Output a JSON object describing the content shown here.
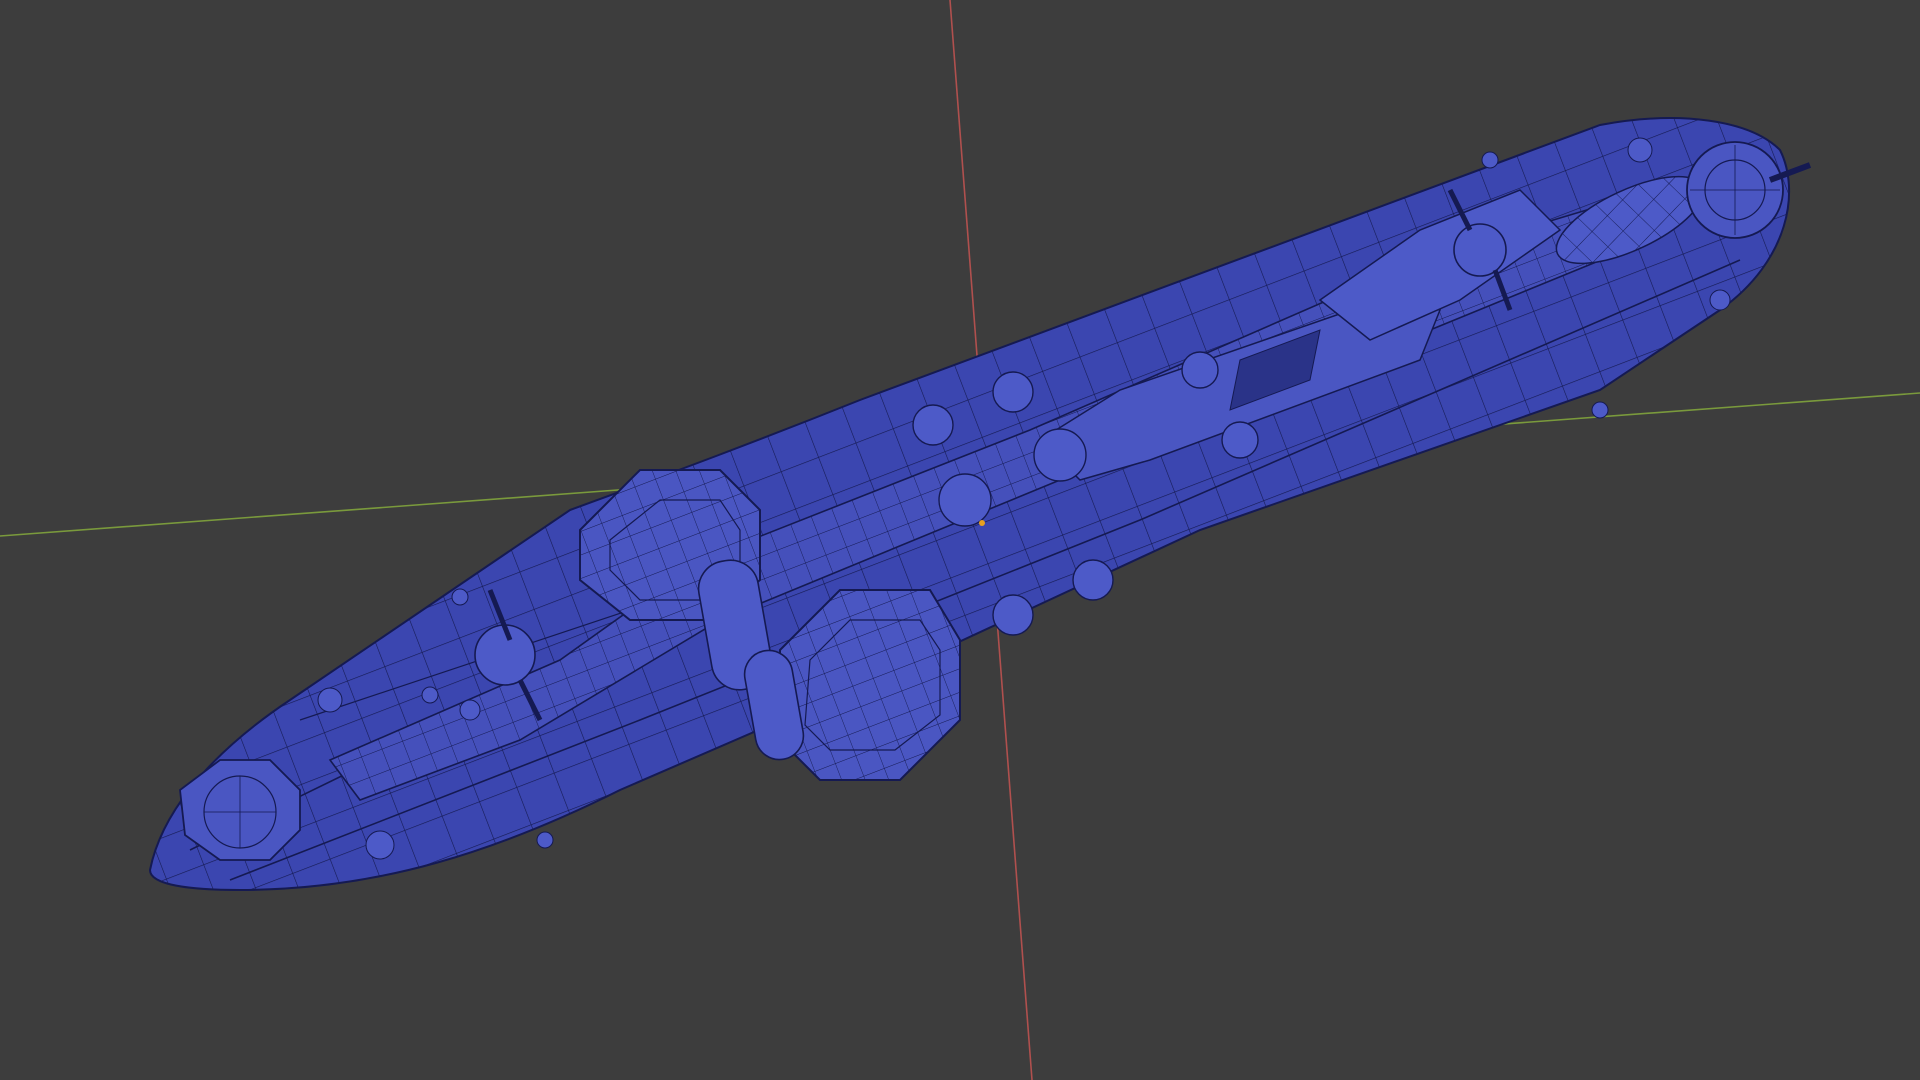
{
  "viewport": {
    "background": "#3d3d3d",
    "x_axis_color": "#7a9a3c",
    "y_axis_color": "#b0504e"
  },
  "model": {
    "fill": "#3b46b0",
    "fill_light": "#4d5ac8",
    "fill_dark": "#2a3388",
    "wire": "#151a52"
  },
  "origin_marker_color": "#e8a020"
}
